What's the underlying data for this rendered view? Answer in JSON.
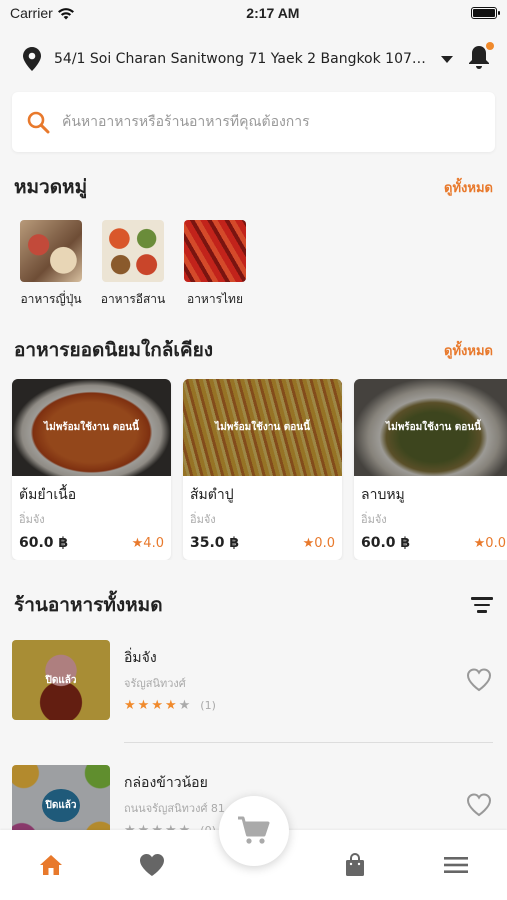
{
  "status_bar": {
    "carrier": "Carrier",
    "time": "2:17 AM",
    "battery_level": 1.0
  },
  "address": {
    "text": "54/1 Soi Charan Sanitwong 71 Yaek 2 Bangkok 10700 ..."
  },
  "search": {
    "placeholder": "ค้นหาอาหารหรือร้านอาหารที่คุณต้องการ"
  },
  "categories": {
    "title": "หมวดหมู่",
    "see_all": "ดูทั้งหมด",
    "items": [
      {
        "label": "อาหารญี่ปุ่น"
      },
      {
        "label": "อาหารอีสาน"
      },
      {
        "label": "อาหารไทย"
      }
    ]
  },
  "popular": {
    "title": "อาหารยอดนิยมใกล้เคียง",
    "see_all": "ดูทั้งหมด",
    "items": [
      {
        "name": "ต้มยำเนื้อ",
        "shop": "อิ่มจัง",
        "price": "60.0 ฿",
        "rating": "★4.0",
        "overlay": "ไม่พร้อมใช้งาน ตอนนี้"
      },
      {
        "name": "ส้มตำปู",
        "shop": "อิ่มจัง",
        "price": "35.0 ฿",
        "rating": "★0.0",
        "overlay": "ไม่พร้อมใช้งาน ตอนนี้"
      },
      {
        "name": "ลาบหมู",
        "shop": "อิ่มจัง",
        "price": "60.0 ฿",
        "rating": "★0.0",
        "overlay": "ไม่พร้อมใช้งาน ตอนนี้"
      }
    ]
  },
  "restaurants": {
    "title": "ร้านอาหารทั้งหมด",
    "items": [
      {
        "name": "อิ่มจัง",
        "address": "จรัญสนิทวงศ์",
        "stars": 4,
        "count": "(1)",
        "status": "ปิดแล้ว"
      },
      {
        "name": "กล่องข้าวน้อย",
        "address": "ถนนจรัญสนิทวงศ์ 81",
        "stars": 0,
        "count": "(0)",
        "status": "ปิดแล้ว"
      }
    ]
  },
  "colors": {
    "accent": "#e8792c",
    "notification": "#f08a2c"
  },
  "tabbar": {
    "icons": [
      "home-icon",
      "heart-icon",
      "cart-icon",
      "bag-icon",
      "menu-icon"
    ]
  }
}
